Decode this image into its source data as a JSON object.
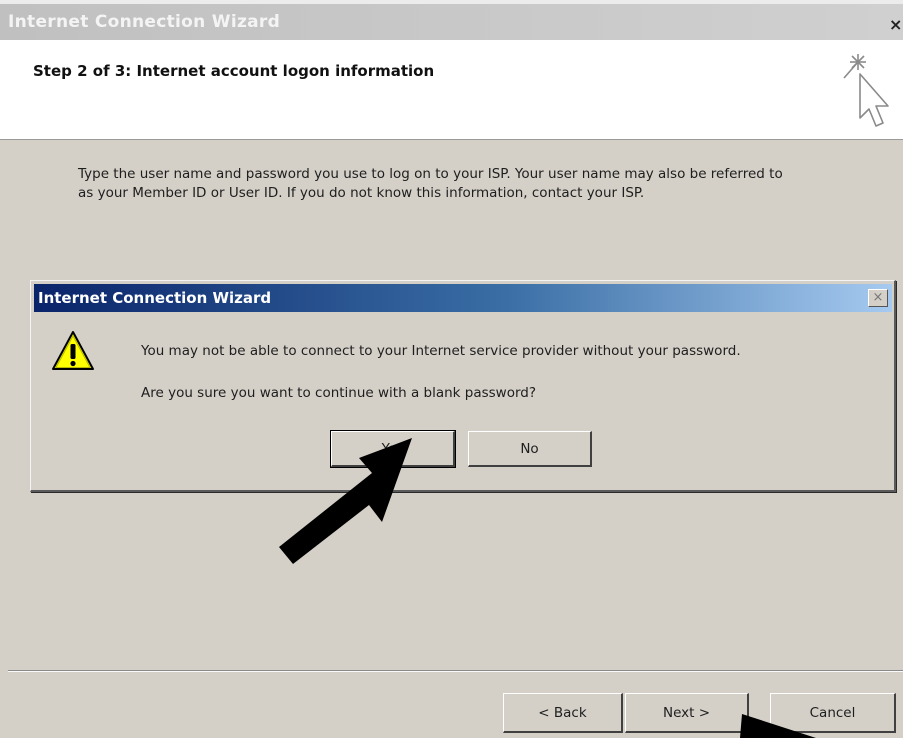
{
  "window": {
    "title": "Internet Connection Wizard",
    "close_glyph": "×"
  },
  "header": {
    "step_title": "Step 2 of 3: Internet account logon information"
  },
  "description": "Type the user name and password you use to log on to your ISP. Your user name may also be referred to as your Member ID or User ID. If you do not know this information, contact your ISP.",
  "dialog": {
    "title": "Internet Connection Wizard",
    "close_glyph": "×",
    "icon": "warning-icon",
    "line1": "You may not be able to connect to your Internet service provider without your password.",
    "line2": "Are you sure you want to continue with a blank password?",
    "yes_label": "Yes",
    "no_label": "No"
  },
  "footer": {
    "back_label": "< Back",
    "next_label": "Next >",
    "cancel_label": "Cancel"
  },
  "colors": {
    "face": "#d4d0c8",
    "dialog_title_start": "#0a246a",
    "dialog_title_end": "#a6caf0",
    "warning_yellow": "#ffff00"
  }
}
